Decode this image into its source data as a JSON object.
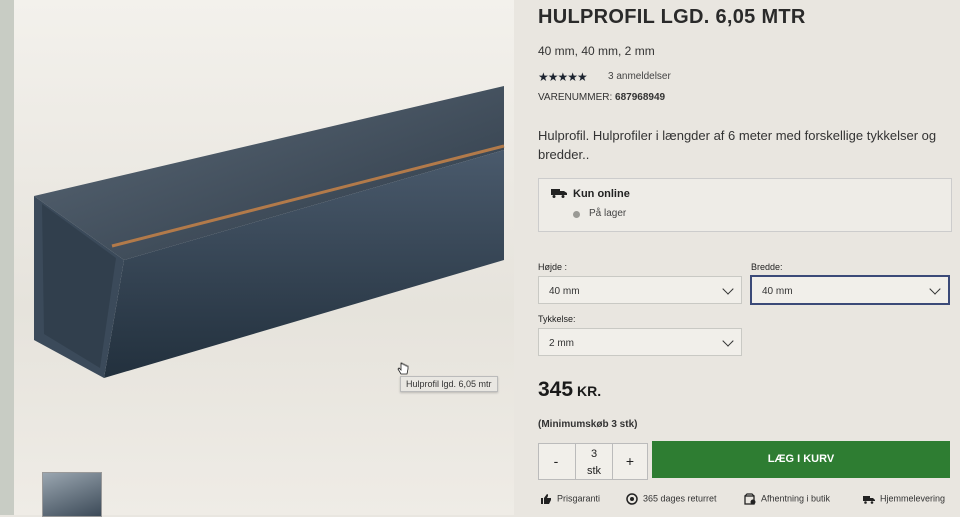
{
  "product": {
    "title": "HULPROFIL LGD. 6,05 MTR",
    "subtitle": "40 mm, 40 mm, 2 mm",
    "rating": 5,
    "stars": "★★★★★",
    "reviews": "3 anmeldelser",
    "sku_label": "VARENUMMER:",
    "sku_value": "687968949",
    "description": "Hulprofil. Hulprofiler i længder af 6 meter med forskellige tykkelser og bredder.."
  },
  "stock": {
    "channel": "Kun online",
    "status": "På lager"
  },
  "options": {
    "height_label": "Højde :",
    "height_value": "40 mm",
    "width_label": "Bredde:",
    "width_value": "40 mm",
    "thickness_label": "Tykkelse:",
    "thickness_value": "2 mm"
  },
  "pricing": {
    "amount": "345",
    "currency": "KR.",
    "min_purchase": "(Minimumskøb 3 stk)"
  },
  "cart": {
    "minus": "-",
    "plus": "+",
    "qty": "3",
    "qty_unit": "stk",
    "add_label": "LÆG I KURV"
  },
  "features": [
    {
      "label": "Prisgaranti",
      "icon": "thumbs-up-icon"
    },
    {
      "label": "365 dages returret",
      "icon": "return-icon"
    },
    {
      "label": "Afhentning i butik",
      "icon": "store-pickup-icon"
    },
    {
      "label": "Hjemmelevering",
      "icon": "truck-icon"
    }
  ],
  "image": {
    "tooltip": "Hulprofil lgd. 6,05 mtr"
  },
  "colors": {
    "cart_button": "#2e7d32",
    "focus_border": "#3b4a78"
  }
}
